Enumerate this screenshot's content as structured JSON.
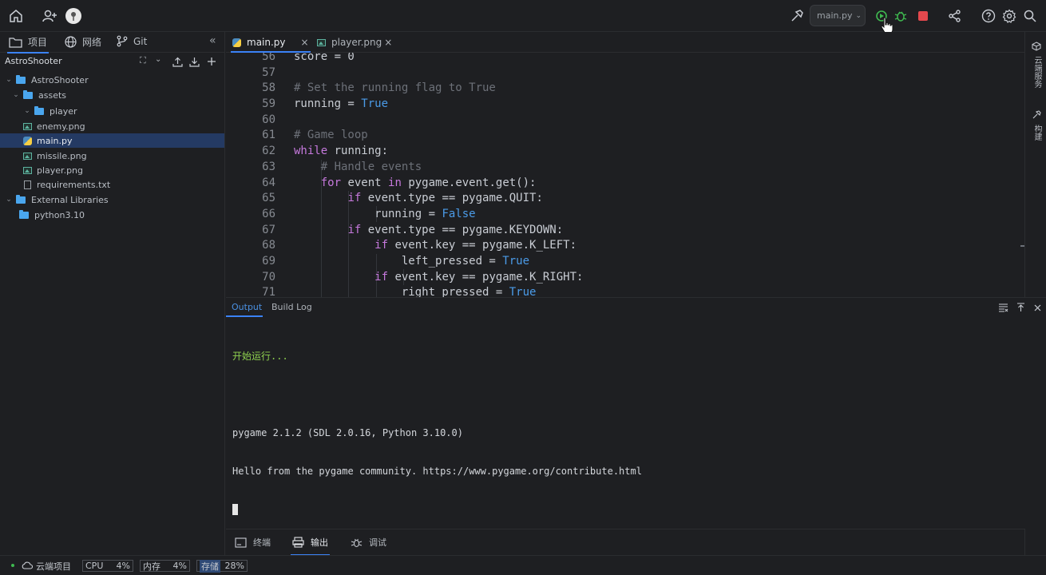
{
  "run_config": "main.py",
  "left_tabs": [
    "项目",
    "网络",
    "Git"
  ],
  "project_name": "AstroShooter",
  "tree": [
    {
      "label": "AstroShooter",
      "type": "folder",
      "expanded": true
    },
    {
      "label": "assets",
      "type": "folder",
      "expanded": true
    },
    {
      "label": "player",
      "type": "folder",
      "expanded": true
    },
    {
      "label": "enemy.png",
      "type": "image"
    },
    {
      "label": "main.py",
      "type": "python",
      "selected": true
    },
    {
      "label": "missile.png",
      "type": "image"
    },
    {
      "label": "player.png",
      "type": "image"
    },
    {
      "label": "requirements.txt",
      "type": "text"
    },
    {
      "label": "External Libraries",
      "type": "library",
      "expanded": true
    },
    {
      "label": "python3.10",
      "type": "folder"
    }
  ],
  "editor_tabs": [
    {
      "label": "main.py",
      "close": "×"
    },
    {
      "label": "player.png",
      "close": "×"
    }
  ],
  "code_lines": [
    {
      "n": "56",
      "t": "score = 0"
    },
    {
      "n": "57",
      "t": ""
    },
    {
      "n": "58",
      "t": "# Set the running flag to True"
    },
    {
      "n": "59",
      "t": "running = True"
    },
    {
      "n": "60",
      "t": ""
    },
    {
      "n": "61",
      "t": "# Game loop"
    },
    {
      "n": "62",
      "t": "while running:"
    },
    {
      "n": "63",
      "t": "    # Handle events"
    },
    {
      "n": "64",
      "t": "    for event in pygame.event.get():"
    },
    {
      "n": "65",
      "t": "        if event.type == pygame.QUIT:"
    },
    {
      "n": "66",
      "t": "            running = False"
    },
    {
      "n": "67",
      "t": "        if event.type == pygame.KEYDOWN:"
    },
    {
      "n": "68",
      "t": "            if event.key == pygame.K_LEFT:"
    },
    {
      "n": "69",
      "t": "                left_pressed = True"
    },
    {
      "n": "70",
      "t": "            if event.key == pygame.K_RIGHT:"
    },
    {
      "n": "71",
      "t": "                right_pressed = True"
    }
  ],
  "right_strip": [
    "云端服务",
    "构建"
  ],
  "panel_tabs": [
    "Output",
    "Build Log"
  ],
  "console": {
    "start": "开始运行...",
    "line1": "pygame 2.1.2 (SDL 2.0.16, Python 3.10.0)",
    "line2": "Hello from the pygame community. https://www.pygame.org/contribute.html"
  },
  "bottom_tabs": [
    "终端",
    "输出",
    "调试"
  ],
  "status": {
    "cloud": "云端项目",
    "cpu_label": "CPU",
    "cpu_value": "4%",
    "mem_label": "内存",
    "mem_value": "4%",
    "storage_label": "存储",
    "storage_value": "28%"
  },
  "colors": {
    "accent": "#3b82f6",
    "keyword": "#c679dd",
    "boolean": "#4b9be8",
    "comment": "#6c7078",
    "console_green": "#8fd14f",
    "stop": "#e5484d"
  }
}
